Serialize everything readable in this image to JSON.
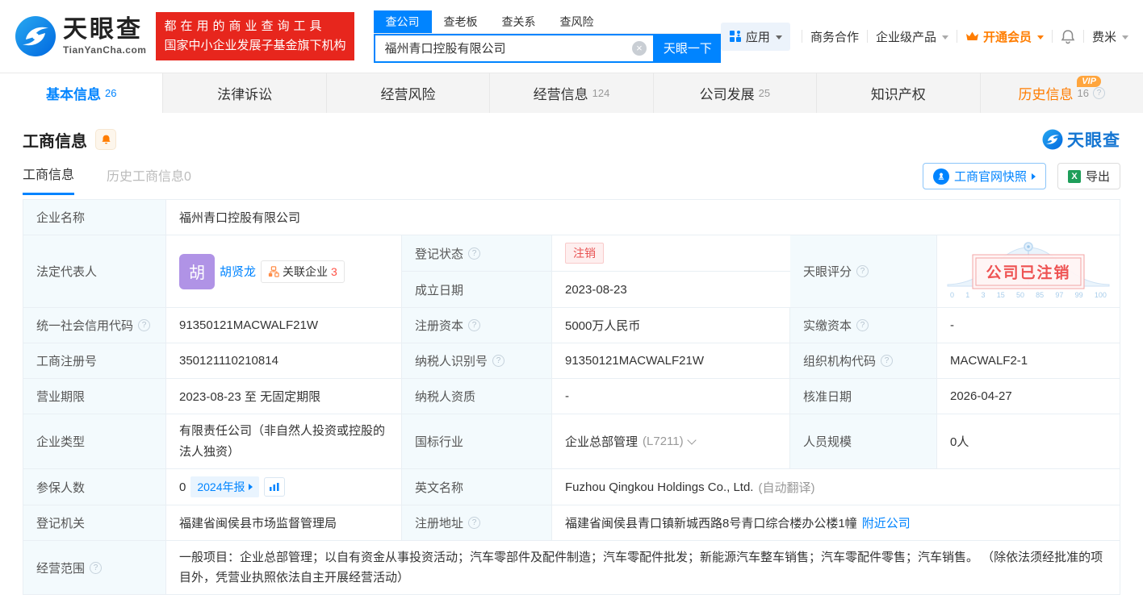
{
  "colors": {
    "accent": "#0084ff",
    "banner_red": "#e7261d",
    "vip_orange": "#ff7d00",
    "status_red": "#e85151",
    "avatar_purple": "#b093e6",
    "excel_green": "#1e9e5a"
  },
  "header": {
    "logo": {
      "title": "天眼查",
      "domain": "TianYanCha.com"
    },
    "banner": {
      "line1": "都在用的商业查询工具",
      "line2": "国家中小企业发展子基金旗下机构"
    },
    "search": {
      "tabs": [
        {
          "label": "查公司"
        },
        {
          "label": "查老板"
        },
        {
          "label": "查关系"
        },
        {
          "label": "查风险"
        }
      ],
      "value": "福州青口控股有限公司",
      "button": "天眼一下"
    },
    "menu": {
      "apps": "应用",
      "cooperation": "商务合作",
      "enterprise": "企业级产品",
      "vip": "开通会员",
      "user": "费米"
    }
  },
  "tabs": [
    {
      "label": "基本信息",
      "count": "26"
    },
    {
      "label": "法律诉讼"
    },
    {
      "label": "经营风险"
    },
    {
      "label": "经营信息",
      "count": "124"
    },
    {
      "label": "公司发展",
      "count": "25"
    },
    {
      "label": "知识产权"
    },
    {
      "label": "历史信息",
      "count": "16",
      "vip": "VIP"
    }
  ],
  "section": {
    "title": "工商信息",
    "subtabs": [
      {
        "label": "工商信息"
      },
      {
        "label": "历史工商信息0"
      }
    ],
    "snapshot_button": "工商官网快照",
    "export_button": "导出",
    "watermark": "天眼查"
  },
  "table": {
    "company_name": {
      "label": "企业名称",
      "value": "福州青口控股有限公司"
    },
    "legal_rep": {
      "label": "法定代表人",
      "avatar_char": "胡",
      "name": "胡贤龙",
      "badge": "关联企业",
      "badge_count": "3"
    },
    "reg_status": {
      "label": "登记状态",
      "value": "注销"
    },
    "establish_date": {
      "label": "成立日期",
      "value": "2023-08-23"
    },
    "tyc_score": {
      "label": "天眼评分",
      "stamp": "公司已注销",
      "axis": [
        "0",
        "1",
        "3",
        "15",
        "50",
        "85",
        "97",
        "99",
        "100"
      ]
    },
    "credit_code": {
      "label": "统一社会信用代码",
      "value": "91350121MACWALF21W"
    },
    "reg_capital": {
      "label": "注册资本",
      "value": "5000万人民币"
    },
    "paid_capital": {
      "label": "实缴资本",
      "value": "-"
    },
    "reg_number": {
      "label": "工商注册号",
      "value": "350121110210814"
    },
    "taxpayer_id": {
      "label": "纳税人识别号",
      "value": "91350121MACWALF21W"
    },
    "org_code": {
      "label": "组织机构代码",
      "value": "MACWALF2-1"
    },
    "business_term": {
      "label": "营业期限",
      "value": "2023-08-23 至 无固定期限"
    },
    "taxpayer_quality": {
      "label": "纳税人资质",
      "value": "-"
    },
    "approval_date": {
      "label": "核准日期",
      "value": "2026-04-27"
    },
    "company_type": {
      "label": "企业类型",
      "value": "有限责任公司（非自然人投资或控股的法人独资）"
    },
    "industry": {
      "label": "国标行业",
      "value": "企业总部管理",
      "code": "(L7211)"
    },
    "staff_size": {
      "label": "人员规模",
      "value": "0人"
    },
    "insured_count": {
      "label": "参保人数",
      "value": "0",
      "report_badge": "2024年报"
    },
    "english_name": {
      "label": "英文名称",
      "value": "Fuzhou Qingkou Holdings Co., Ltd.",
      "note": "(自动翻译)"
    },
    "reg_authority": {
      "label": "登记机关",
      "value": "福建省闽侯县市场监督管理局"
    },
    "reg_address": {
      "label": "注册地址",
      "value": "福建省闽侯县青口镇新城西路8号青口综合楼办公楼1幢",
      "link": "附近公司"
    },
    "business_scope": {
      "label": "经营范围",
      "value": "一般项目：企业总部管理；以自有资金从事投资活动；汽车零部件及配件制造；汽车零配件批发；新能源汽车整车销售；汽车零配件零售；汽车销售。 （除依法须经批准的项目外，凭营业执照依法自主开展经营活动）"
    }
  }
}
